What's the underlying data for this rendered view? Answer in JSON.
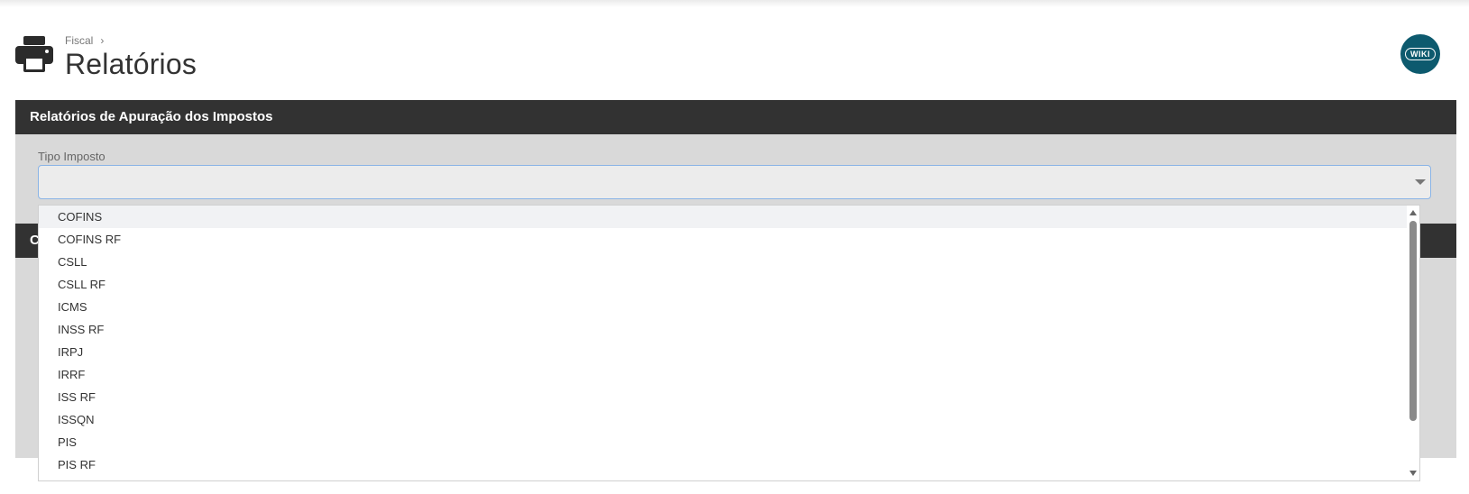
{
  "header": {
    "breadcrumb": "Fiscal",
    "breadcrumb_separator": "›",
    "title": "Relatórios",
    "page_icon": "printer-icon"
  },
  "wiki": {
    "label": "WIKI",
    "color": "#0d5a6e"
  },
  "panel": {
    "title": "Relatórios de Apuração dos Impostos",
    "field_label": "Tipo Imposto",
    "field_value": ""
  },
  "panel2": {
    "title_visible": "C"
  },
  "dropdown": {
    "items": [
      "COFINS",
      "COFINS RF",
      "CSLL",
      "CSLL RF",
      "ICMS",
      "INSS RF",
      "IRPJ",
      "IRRF",
      "ISS RF",
      "ISSQN",
      "PIS",
      "PIS RF"
    ],
    "highlighted": "COFINS"
  },
  "colors": {
    "panel_header": "#323232",
    "panel_body": "#d9d9d9",
    "select_border": "#8ab4e6"
  }
}
